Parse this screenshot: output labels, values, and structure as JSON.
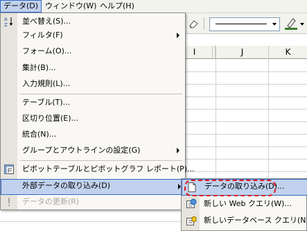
{
  "menubar": {
    "items": [
      {
        "label": "データ(D)"
      },
      {
        "label": "ウィンドウ(W)"
      },
      {
        "label": "ヘルプ(H)"
      }
    ]
  },
  "sheet": {
    "columns": [
      "I",
      "J",
      "K"
    ]
  },
  "data_menu": {
    "items": [
      {
        "label": "並べ替え(S)..."
      },
      {
        "label": "フィルタ(F)"
      },
      {
        "label": "フォーム(O)..."
      },
      {
        "label": "集計(B)..."
      },
      {
        "label": "入力規則(L)..."
      },
      {
        "label": "テーブル(T)..."
      },
      {
        "label": "区切り位置(E)..."
      },
      {
        "label": "統合(N)..."
      },
      {
        "label": "グループとアウトラインの設定(G)"
      },
      {
        "label": "ピボットテーブルとピボットグラフ レポート(P)..."
      },
      {
        "label": "外部データの取り込み(D)"
      },
      {
        "label": "データの更新(R)"
      }
    ]
  },
  "import_submenu": {
    "items": [
      {
        "label": "データの取り込み(D)..."
      },
      {
        "label": "新しい Web クエリ(W)..."
      },
      {
        "label": "新しいデータベース クエリ(N)..."
      }
    ]
  },
  "colors": {
    "highlight": "#c1d2ee",
    "highlight_border": "#316ac5",
    "annotation_red": "#e0151d"
  }
}
